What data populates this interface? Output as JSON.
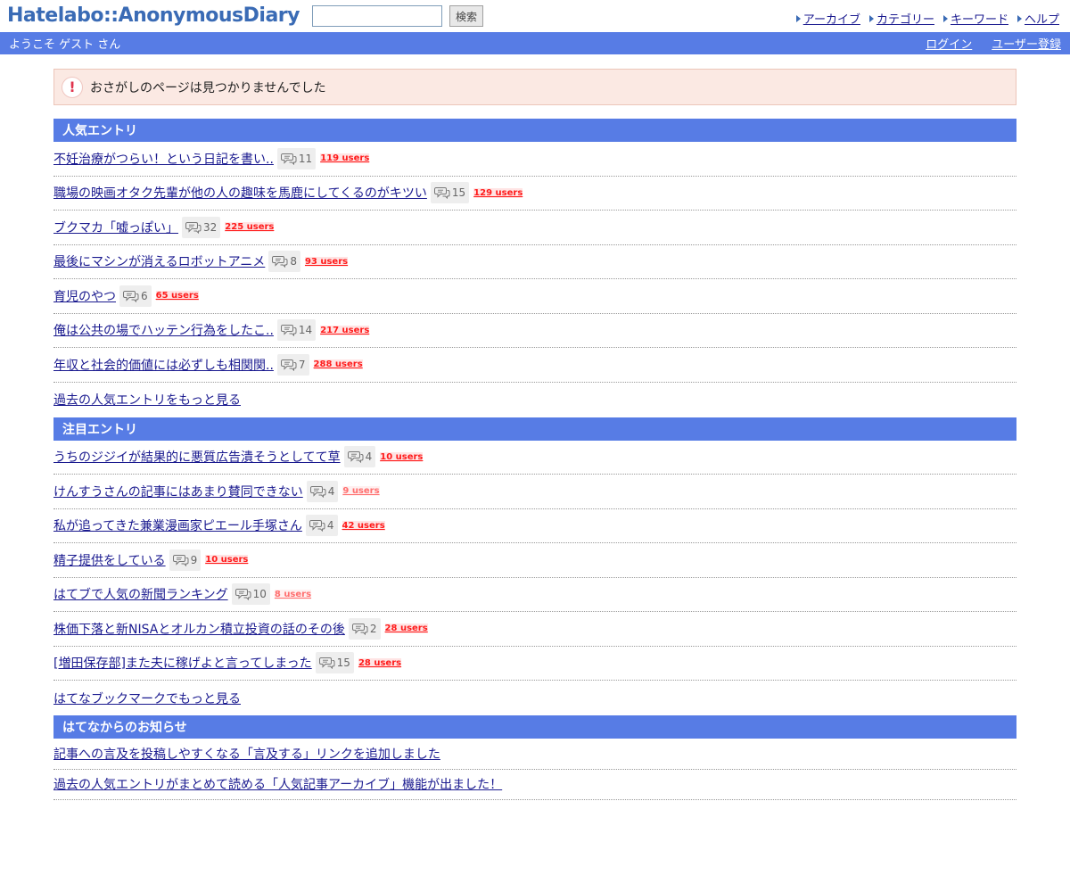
{
  "header": {
    "logo": "Hatelabo::AnonymousDiary",
    "search_placeholder": "",
    "search_button": "検索",
    "nav": [
      "アーカイブ",
      "カテゴリー",
      "キーワード",
      "ヘルプ"
    ]
  },
  "welcome": {
    "greeting": "ようこそ ゲスト さん",
    "login": "ログイン",
    "register": "ユーザー登録"
  },
  "error_message": "おさがしのページは見つかりませんでした",
  "popular": {
    "heading": "人気エントリ",
    "entries": [
      {
        "title": "不妊治療がつらい！という日記を書い..",
        "comments": "11",
        "users": "119 users"
      },
      {
        "title": "職場の映画オタク先輩が他の人の趣味を馬鹿にしてくるのがキツい",
        "comments": "15",
        "users": "129 users"
      },
      {
        "title": "ブクマカ「嘘っぽい」",
        "comments": "32",
        "users": "225 users"
      },
      {
        "title": "最後にマシンが消えるロボットアニメ",
        "comments": "8",
        "users": "93 users"
      },
      {
        "title": "育児のやつ",
        "comments": "6",
        "users": "65 users"
      },
      {
        "title": "俺は公共の場でハッテン行為をしたこ..",
        "comments": "14",
        "users": "217 users"
      },
      {
        "title": "年収と社会的価値には必ずしも相関関..",
        "comments": "7",
        "users": "288 users"
      }
    ],
    "more": "過去の人気エントリをもっと見る"
  },
  "notable": {
    "heading": "注目エントリ",
    "entries": [
      {
        "title": "うちのジジイが結果的に悪質広告潰そうとしてて草",
        "comments": "4",
        "users": "10 users"
      },
      {
        "title": "けんすうさんの記事にはあまり賛同できない",
        "comments": "4",
        "users": "9 users"
      },
      {
        "title": "私が追ってきた兼業漫画家ピエール手塚さん",
        "comments": "4",
        "users": "42 users"
      },
      {
        "title": "精子提供をしている",
        "comments": "9",
        "users": "10 users"
      },
      {
        "title": "はてブで人気の新聞ランキング",
        "comments": "10",
        "users": "8 users"
      },
      {
        "title": "株価下落と新NISAとオルカン積立投資の話のその後",
        "comments": "2",
        "users": "28 users"
      },
      {
        "title": "[増田保存部]また夫に稼げよと言ってしまった",
        "comments": "15",
        "users": "28 users"
      }
    ],
    "more": "はてなブックマークでもっと見る"
  },
  "news": {
    "heading": "はてなからのお知らせ",
    "items": [
      "記事への言及を投稿しやすくなる「言及する」リンクを追加しました",
      "過去の人気エントリがまとめて読める「人気記事アーカイブ」機能が出ました！"
    ]
  }
}
